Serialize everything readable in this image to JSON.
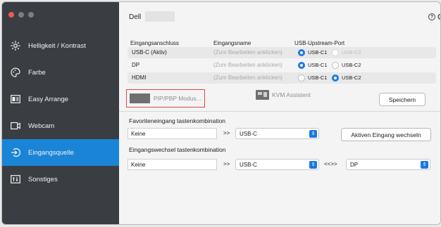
{
  "sidebar": {
    "items": [
      {
        "label": "Helligkeit / Kontrast",
        "icon": "sun-icon"
      },
      {
        "label": "Farbe",
        "icon": "palette-icon"
      },
      {
        "label": "Easy Arrange",
        "icon": "layout-icon"
      },
      {
        "label": "Webcam",
        "icon": "webcam-icon"
      },
      {
        "label": "Eingangsquelle",
        "icon": "input-source-icon",
        "active": true
      },
      {
        "label": "Sonstiges",
        "icon": "misc-icon"
      }
    ]
  },
  "header": {
    "title": "Dell"
  },
  "input_table": {
    "headers": [
      "Eingangsanschluss",
      "Eingangsname",
      "USB-Upstream-Port"
    ],
    "rows": [
      {
        "port": "USB-C (Aktiv)",
        "name_hint": "(Zum Bearbeiten anklicken)",
        "usb_c1": "USB-C1",
        "usb_c2": "USB-C2",
        "selected": "USB-C1",
        "c2_disabled": true
      },
      {
        "port": "DP",
        "name_hint": "(Zum Bearbeiten anklicken)",
        "usb_c1": "USB-C1",
        "usb_c2": "USB-C2",
        "selected": "USB-C1"
      },
      {
        "port": "HDMI",
        "name_hint": "(Zum Bearbeiten anklicken)",
        "usb_c1": "USB-C1",
        "usb_c2": "USB-C2",
        "selected": "USB-C2"
      }
    ]
  },
  "actions": {
    "pip_label": "PIP/PBP Modus...",
    "kvm_label": "KVM Assistent",
    "save_label": "Speichern"
  },
  "favorite_shortcut": {
    "label": "Favoriteneingang tastenkombination",
    "key_value": "Keine",
    "arrow": ">>",
    "target": "USB-C",
    "switch_button": "Aktiven Eingang wechseln"
  },
  "switch_shortcut": {
    "label": "Eingangswechsel tastenkombination",
    "key_value": "Keine",
    "arrow": ">>",
    "source": "USB-C",
    "swap": "<<>>",
    "target": "DP"
  },
  "colors": {
    "accent": "#1a85d6",
    "sidebar_bg": "#3a3d42",
    "highlight_border": "#e04848"
  }
}
